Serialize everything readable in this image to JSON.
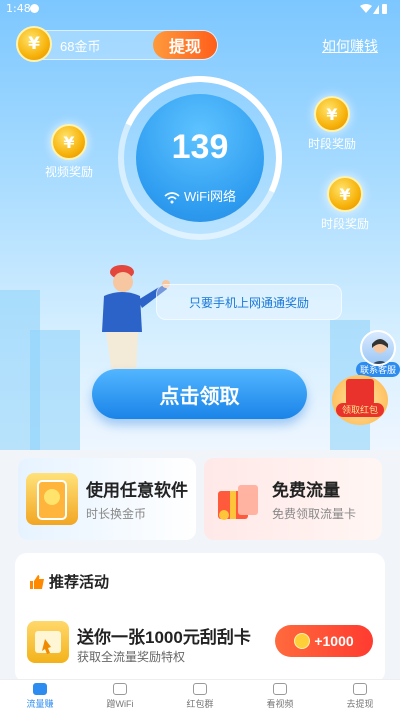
{
  "status_bar": {
    "time": "1:48"
  },
  "header": {
    "coins_label": "68金币",
    "withdraw_label": "提现",
    "how_to_earn_label": "如何赚钱"
  },
  "meter": {
    "value": "139",
    "network_label": "WiFi网络"
  },
  "rewards": {
    "video": "视频奖励",
    "period_1": "时段奖励",
    "period_2": "时段奖励"
  },
  "bubble_text": "只要手机上网通通奖励",
  "claim_button": "点击领取",
  "service_label": "联系客服",
  "redpacket_label": "领取红包",
  "cards": [
    {
      "title": "使用任意软件",
      "subtitle": "时长换金币"
    },
    {
      "title": "免费流量",
      "subtitle": "免费领取流量卡"
    }
  ],
  "recommended": {
    "title": "推荐活动",
    "activity_title": "送你一张1000元刮刮卡",
    "activity_subtitle": "获取全流量奖励特权",
    "activity_reward": "+1000"
  },
  "tabs": [
    {
      "label": "流量赚"
    },
    {
      "label": "蹭WiFi"
    },
    {
      "label": "红包群"
    },
    {
      "label": "看视频"
    },
    {
      "label": "去提现"
    }
  ],
  "colors": {
    "accent": "#2d8cf0",
    "orange": "#ff6a1a",
    "coin": "#f7b20a"
  }
}
